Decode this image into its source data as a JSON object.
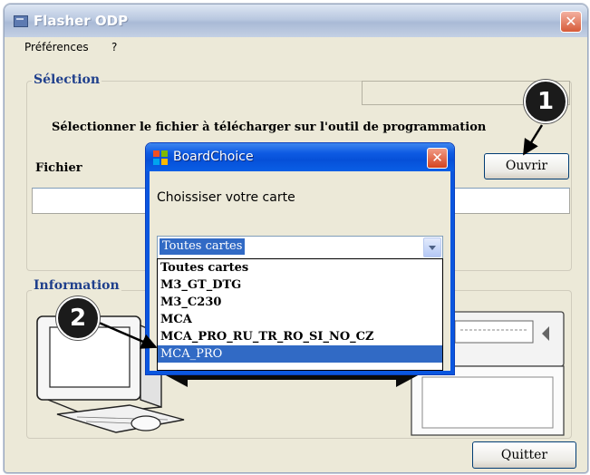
{
  "window": {
    "title": "Flasher ODP",
    "close_symbol": "✕"
  },
  "menu": {
    "items": [
      "Préférences",
      "?"
    ]
  },
  "selection": {
    "group_label": "Sélection",
    "instruction": "Sélectionner le fichier à télécharger sur l'outil de programmation",
    "file_label": "Fichier",
    "open_button": "Ouvrir"
  },
  "information": {
    "group_label": "Information"
  },
  "quit_button": "Quitter",
  "dialog": {
    "title": "BoardChoice",
    "close_symbol": "✕",
    "prompt": "Choissiser votre carte",
    "selected_value": "Toutes cartes",
    "options": [
      "Toutes cartes",
      "M3_GT_DTG",
      "M3_C230",
      "MCA",
      "MCA_PRO_RU_TR_RO_SI_NO_CZ",
      "MCA_PRO"
    ],
    "highlighted_option": "MCA_PRO"
  },
  "callouts": [
    "1",
    "2"
  ],
  "colors": {
    "title_blue": "#0650d8",
    "selection_blue": "#316ac5",
    "group_label": "#1f3f8c"
  }
}
